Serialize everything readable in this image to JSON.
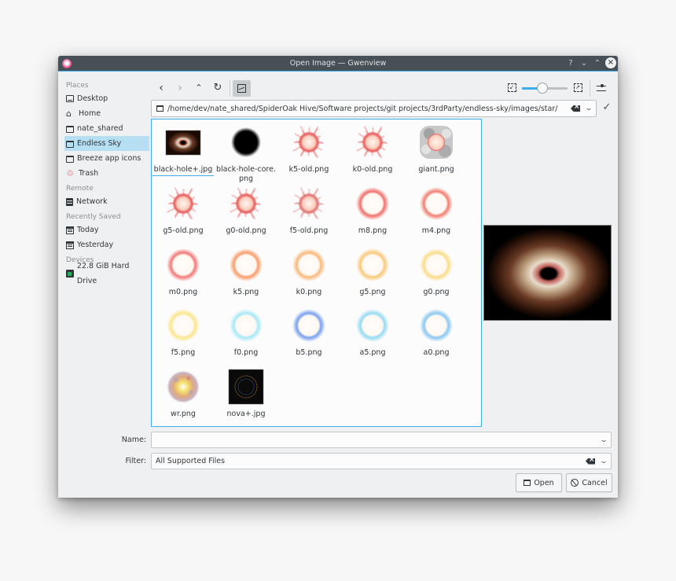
{
  "window": {
    "title": "Open Image — Gwenview",
    "controls": {
      "help": "?",
      "minimize": "⌄",
      "maximize": "⌃",
      "close": "×"
    }
  },
  "sidebar": {
    "sections": [
      {
        "label": "Places",
        "items": [
          {
            "label": "Desktop",
            "icon": "desktop-icon"
          },
          {
            "label": "Home",
            "icon": "home-icon"
          },
          {
            "label": "nate_shared",
            "icon": "folder-icon"
          },
          {
            "label": "Endless Sky",
            "icon": "folder-icon",
            "selected": true
          },
          {
            "label": "Breeze app icons",
            "icon": "folder-icon"
          },
          {
            "label": "Trash",
            "icon": "trash-icon"
          }
        ]
      },
      {
        "label": "Remote",
        "items": [
          {
            "label": "Network",
            "icon": "network-icon"
          }
        ]
      },
      {
        "label": "Recently Saved",
        "items": [
          {
            "label": "Today",
            "icon": "calendar-icon"
          },
          {
            "label": "Yesterday",
            "icon": "calendar-icon"
          }
        ]
      },
      {
        "label": "Devices",
        "items": [
          {
            "label": "22.8 GiB Hard Drive",
            "icon": "hard-drive-icon"
          }
        ]
      }
    ]
  },
  "toolbar": {
    "back": "‹",
    "forward": "›",
    "up": "⌃",
    "reload": "↻",
    "preview_toggle_active": true,
    "zoom_out_icon": "zoom-out-icon",
    "zoom_in_icon": "zoom-in-icon",
    "zoom_level": 0.45
  },
  "location": {
    "path": "/home/dev/nate_shared/SpiderOak Hive/Software projects/git projects/3rdParty/endless-sky/images/star/"
  },
  "files": [
    {
      "name": "black-hole+.jpg",
      "kind": "blackhole",
      "current": true
    },
    {
      "name": "black-hole-core.\npng",
      "kind": "core"
    },
    {
      "name": "k5-old.png",
      "kind": "spiky",
      "color": "#e85a5a"
    },
    {
      "name": "k0-old.png",
      "kind": "spiky",
      "color": "#e85a5a"
    },
    {
      "name": "giant.png",
      "kind": "giant"
    },
    {
      "name": "g5-old.png",
      "kind": "spiky",
      "color": "#e85a5a"
    },
    {
      "name": "g0-old.png",
      "kind": "spiky",
      "color": "#e85a5a"
    },
    {
      "name": "f5-old.png",
      "kind": "spiky",
      "color": "#e07070"
    },
    {
      "name": "m8.png",
      "kind": "glow",
      "color": "#f0605a"
    },
    {
      "name": "m4.png",
      "kind": "glow",
      "color": "#f07060"
    },
    {
      "name": "m0.png",
      "kind": "glow",
      "color": "#f06a6a"
    },
    {
      "name": "k5.png",
      "kind": "glow",
      "color": "#f7925a"
    },
    {
      "name": "k0.png",
      "kind": "glow",
      "color": "#f8b06a"
    },
    {
      "name": "g5.png",
      "kind": "glow",
      "color": "#f9c26a"
    },
    {
      "name": "g0.png",
      "kind": "glow",
      "color": "#fad87a"
    },
    {
      "name": "f5.png",
      "kind": "glow",
      "color": "#fbe37e"
    },
    {
      "name": "f0.png",
      "kind": "glow",
      "color": "#9ee6f7"
    },
    {
      "name": "b5.png",
      "kind": "glow",
      "color": "#6a96ec"
    },
    {
      "name": "a5.png",
      "kind": "glow",
      "color": "#8ad6f2"
    },
    {
      "name": "a0.png",
      "kind": "glow",
      "color": "#7cc2f0"
    },
    {
      "name": "wr.png",
      "kind": "wr"
    },
    {
      "name": "nova+.jpg",
      "kind": "nova"
    }
  ],
  "form": {
    "name_label": "Name:",
    "name_value": "",
    "filter_label": "Filter:",
    "filter_value": "All Supported Files"
  },
  "buttons": {
    "open": "Open",
    "cancel": "Cancel"
  },
  "colors": {
    "accent": "#3daee9",
    "titlebar": "#475057",
    "selection": "#b6dff4"
  }
}
